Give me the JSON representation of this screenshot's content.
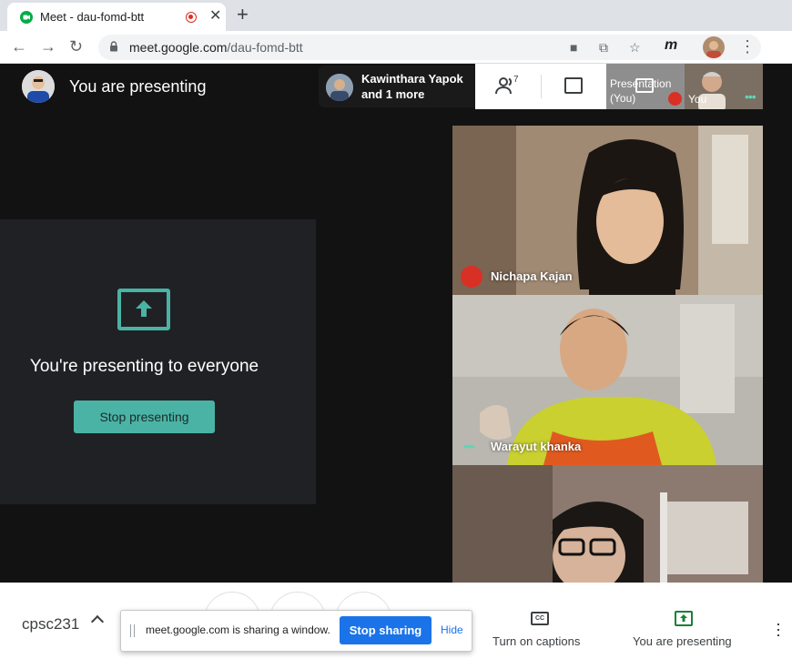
{
  "browser": {
    "tab_title": "Meet - dau-fomd-btt",
    "url_host": "meet.google.com",
    "url_path": "/dau-fomd-btt",
    "extension_label": "m"
  },
  "meet": {
    "presenting_title": "You are presenting",
    "people_chip": {
      "name": "Kawinthara Yapok",
      "more": "and 1 more"
    },
    "participant_count": "7",
    "thumb_presentation_label": [
      "Presentation",
      "(You)"
    ],
    "thumb_you_label": "You"
  },
  "panel": {
    "message": "You're presenting to everyone",
    "stop_label": "Stop presenting"
  },
  "tiles": [
    {
      "name": "Nichapa Kajan",
      "muted": true
    },
    {
      "name": "Warayut khanka",
      "muted": false
    },
    {
      "name": "",
      "muted": false
    }
  ],
  "bottom": {
    "meeting_code": "cpsc231",
    "captions_label": "Turn on captions",
    "captions_icon_text": "CC",
    "presenting_label": "You are presenting"
  },
  "share_notice": {
    "text": "meet.google.com is sharing a window.",
    "stop_label": "Stop sharing",
    "hide_label": "Hide"
  },
  "colors": {
    "accent": "#4ab3a5",
    "stop_sharing_blue": "#1a73e8",
    "mute_red": "#d93025",
    "speaking_green": "#5bd6b6"
  }
}
